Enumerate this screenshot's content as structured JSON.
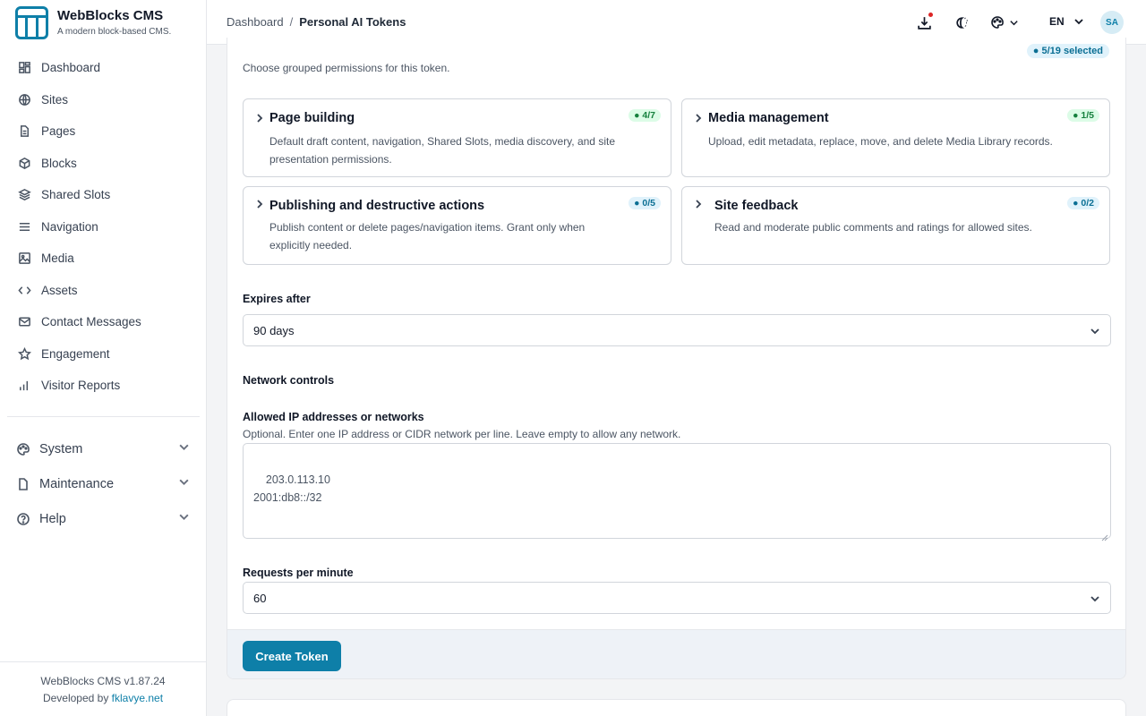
{
  "brand": {
    "title": "WebBlocks CMS",
    "subtitle": "A modern block-based CMS."
  },
  "sidebar": {
    "items": [
      {
        "label": "Dashboard",
        "icon": "dashboard-icon"
      },
      {
        "label": "Sites",
        "icon": "globe-icon"
      },
      {
        "label": "Pages",
        "icon": "document-icon"
      },
      {
        "label": "Blocks",
        "icon": "cube-icon"
      },
      {
        "label": "Shared Slots",
        "icon": "layers-icon"
      },
      {
        "label": "Navigation",
        "icon": "menu-icon"
      },
      {
        "label": "Media",
        "icon": "image-icon"
      },
      {
        "label": "Assets",
        "icon": "code-icon"
      },
      {
        "label": "Contact Messages",
        "icon": "mail-icon"
      },
      {
        "label": "Engagement",
        "icon": "star-icon"
      },
      {
        "label": "Visitor Reports",
        "icon": "bar-chart-icon"
      }
    ],
    "groups": [
      {
        "label": "System",
        "icon": "palette-icon"
      },
      {
        "label": "Maintenance",
        "icon": "file-icon"
      },
      {
        "label": "Help",
        "icon": "help-icon"
      }
    ],
    "footer": {
      "version": "WebBlocks CMS v1.87.24",
      "developed_by": "Developed by",
      "link": "fklavye.net"
    }
  },
  "topbar": {
    "breadcrumb": {
      "root": "Dashboard",
      "separator": "/",
      "current": "Personal AI Tokens"
    },
    "language": "EN",
    "avatar": "SA"
  },
  "form": {
    "selected_badge": "● 5/19 selected",
    "permissions_hint": "Choose grouped permissions for this token.",
    "groups": [
      {
        "title": "Page building",
        "count": "● 4/7",
        "description": "Default draft content, navigation, Shared Slots, media discovery, and site presentation permissions."
      },
      {
        "title": "Media management",
        "count": "● 1/5",
        "description": "Upload, edit metadata, replace, move, and delete Media Library records."
      },
      {
        "title": "Publishing and destructive actions",
        "count": "● 0/5",
        "description": "Publish content or delete pages/navigation items. Grant only when explicitly needed."
      },
      {
        "title": "Site feedback",
        "count": "● 0/2",
        "description": "Read and moderate public comments and ratings for allowed sites."
      }
    ],
    "expires_label": "Expires after",
    "expires_value": "90 days",
    "network_heading": "Network controls",
    "ip_label": "Allowed IP addresses or networks",
    "ip_hint": "Optional. Enter one IP address or CIDR network per line. Leave empty to allow any network.",
    "ip_value": "203.0.113.10\n2001:db8::/32",
    "rpm_label": "Requests per minute",
    "rpm_value": "60",
    "submit_label": "Create Token"
  },
  "colors": {
    "accent": "#0e7fa8",
    "green_badge": "#dcfce7",
    "blue_badge": "#e0f2fb"
  }
}
